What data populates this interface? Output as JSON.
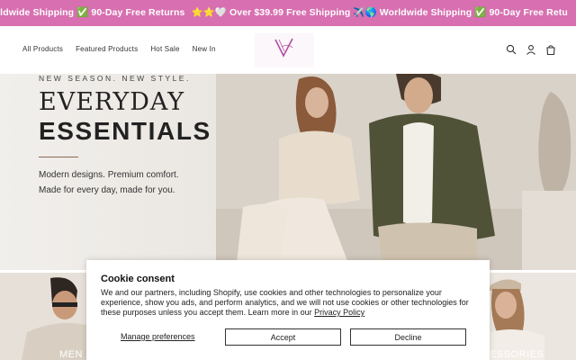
{
  "announcement": {
    "items": [
      "rldwide Shipping ✅ 90-Day Free Returns",
      "⭐⭐🤍 Over $39.99 Free Shipping ✈️🌎 Worldwide Shipping ✅ 90-Day Free Retu"
    ],
    "background": "#d76fb0"
  },
  "header": {
    "nav": [
      "All Products",
      "Featured Products",
      "Hot Sale",
      "New In"
    ],
    "icons": [
      "search-icon",
      "account-icon",
      "cart-icon"
    ],
    "brand_color": "#b24fa0"
  },
  "hero": {
    "eyebrow": "NEW SEASON. NEW STYLE.",
    "title_line1": "EVERYDAY",
    "title_line2": "ESSENTIALS",
    "subtitle_line1": "Modern designs. Premium comfort.",
    "subtitle_line2": "Made for every day, made for you."
  },
  "tiles": {
    "left_label": "MEN",
    "right_label": "ESSORIES"
  },
  "cookie": {
    "title": "Cookie consent",
    "body": "We and our partners, including Shopify, use cookies and other technologies to personalize your experience, show you ads, and perform analytics, and we will not use cookies or other technologies for these purposes unless you accept them. Learn more in our ",
    "privacy_link": "Privacy Policy",
    "manage_label": "Manage preferences",
    "accept_label": "Accept",
    "decline_label": "Decline"
  }
}
